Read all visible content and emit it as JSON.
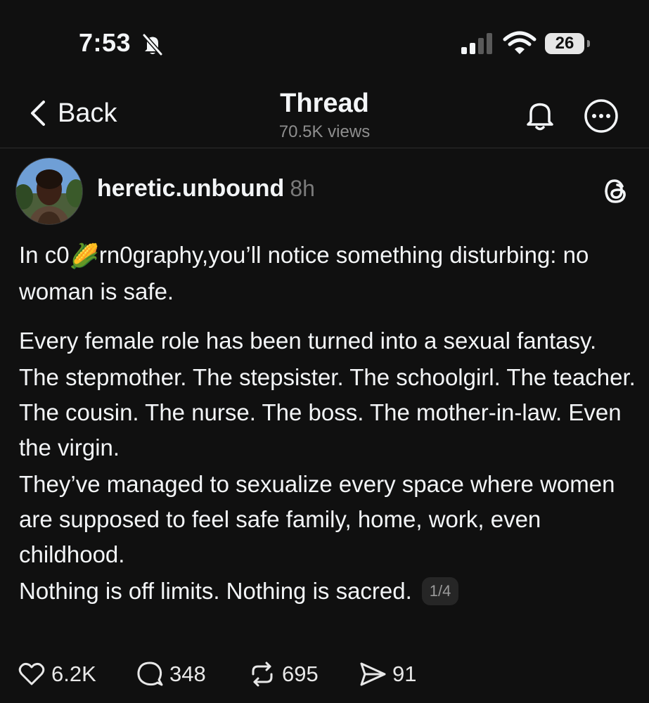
{
  "status_bar": {
    "time": "7:53",
    "battery": "26"
  },
  "nav": {
    "back_label": "Back",
    "title": "Thread",
    "views": "70.5K views"
  },
  "post": {
    "username": "heretic.unbound",
    "time_ago": "8h",
    "p1_a": "In c0",
    "p1_emoji": "🌽",
    "p1_b": "rn0graphy,you’ll notice something disturbing: no woman is safe.",
    "p2": "Every female role has been turned into a sexual fantasy.",
    "p3": "The stepmother. The stepsister. The schoolgirl. The teacher. The cousin. The nurse. The boss. The mother-in-law. Even the virgin.",
    "p4": "They’ve managed to sexualize every space where women are supposed to feel safe  family, home, work, even childhood.",
    "p5": "Nothing is off limits. Nothing is sacred.",
    "page_indicator": "1/4"
  },
  "actions": {
    "likes": "6.2K",
    "replies": "348",
    "reposts": "695",
    "shares": "91"
  },
  "icons": [
    "bell-slash-icon",
    "signal-icon",
    "wifi-icon",
    "battery-icon",
    "chevron-left-icon",
    "bell-icon",
    "more-icon",
    "threads-logo-icon",
    "heart-icon",
    "comment-icon",
    "repost-icon",
    "send-icon"
  ]
}
